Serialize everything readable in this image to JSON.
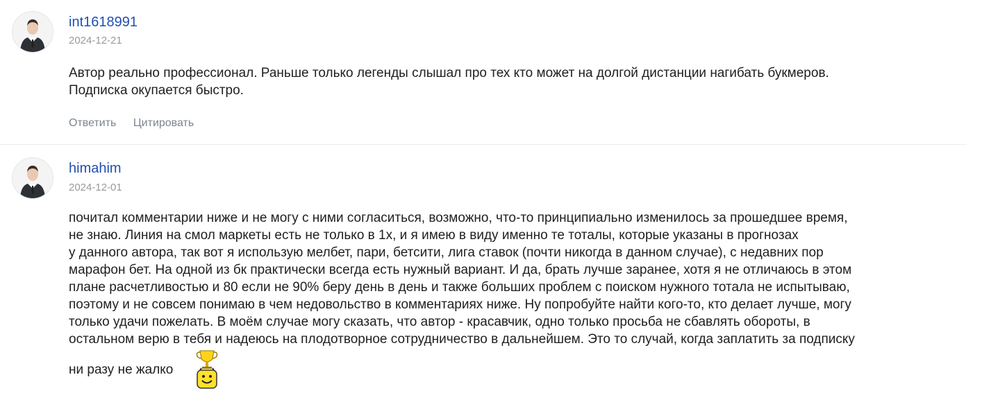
{
  "comments": [
    {
      "username": "int1618991",
      "date": "2024-12-21",
      "lines": [
        "Автор реально профессионал. Раньше только легенды слышал про тех кто может на долгой дистанции нагибать букмеров.",
        "Подписка окупается быстро."
      ],
      "actions": {
        "reply": "Ответить",
        "quote": "Цитировать"
      }
    },
    {
      "username": "himahim",
      "date": "2024-12-01",
      "lines": [
        "почитал комментарии ниже и не могу с ними согласиться, возможно, что-то принципиально изменилось за прошедшее время,",
        "не знаю. Линия на смол маркеты есть не только в 1х, и я имею в виду именно те тоталы, которые указаны в прогнозах",
        "у данного автора, так вот я использую мелбет, пари, бетсити, лига ставок (почти никогда в данном случае), с недавних пор",
        "марафон бет. На одной из бк практически всегда есть нужный вариант. И да, брать лучше заранее, хотя я не отличаюсь в этом",
        "плане расчетливостью и 80 если не 90% беру день в день и также больших проблем с поиском нужного тотала не испытываю,",
        "поэтому и не совсем понимаю в чем недовольство в комментариях ниже. Ну попробуйте найти кого-то, кто делает лучше, могу",
        "только удачи пожелать. В моём случае могу сказать, что автор - красавчик, одно только просьба не сбавлять обороты, в",
        "остальном верю в тебя и надеюсь на плодотворное сотрудничество в дальнейшем. Это то случай, когда заплатить за подписку"
      ],
      "last_line": "ни разу не жалко",
      "emoji": "trophy-smiley-icon"
    }
  ]
}
